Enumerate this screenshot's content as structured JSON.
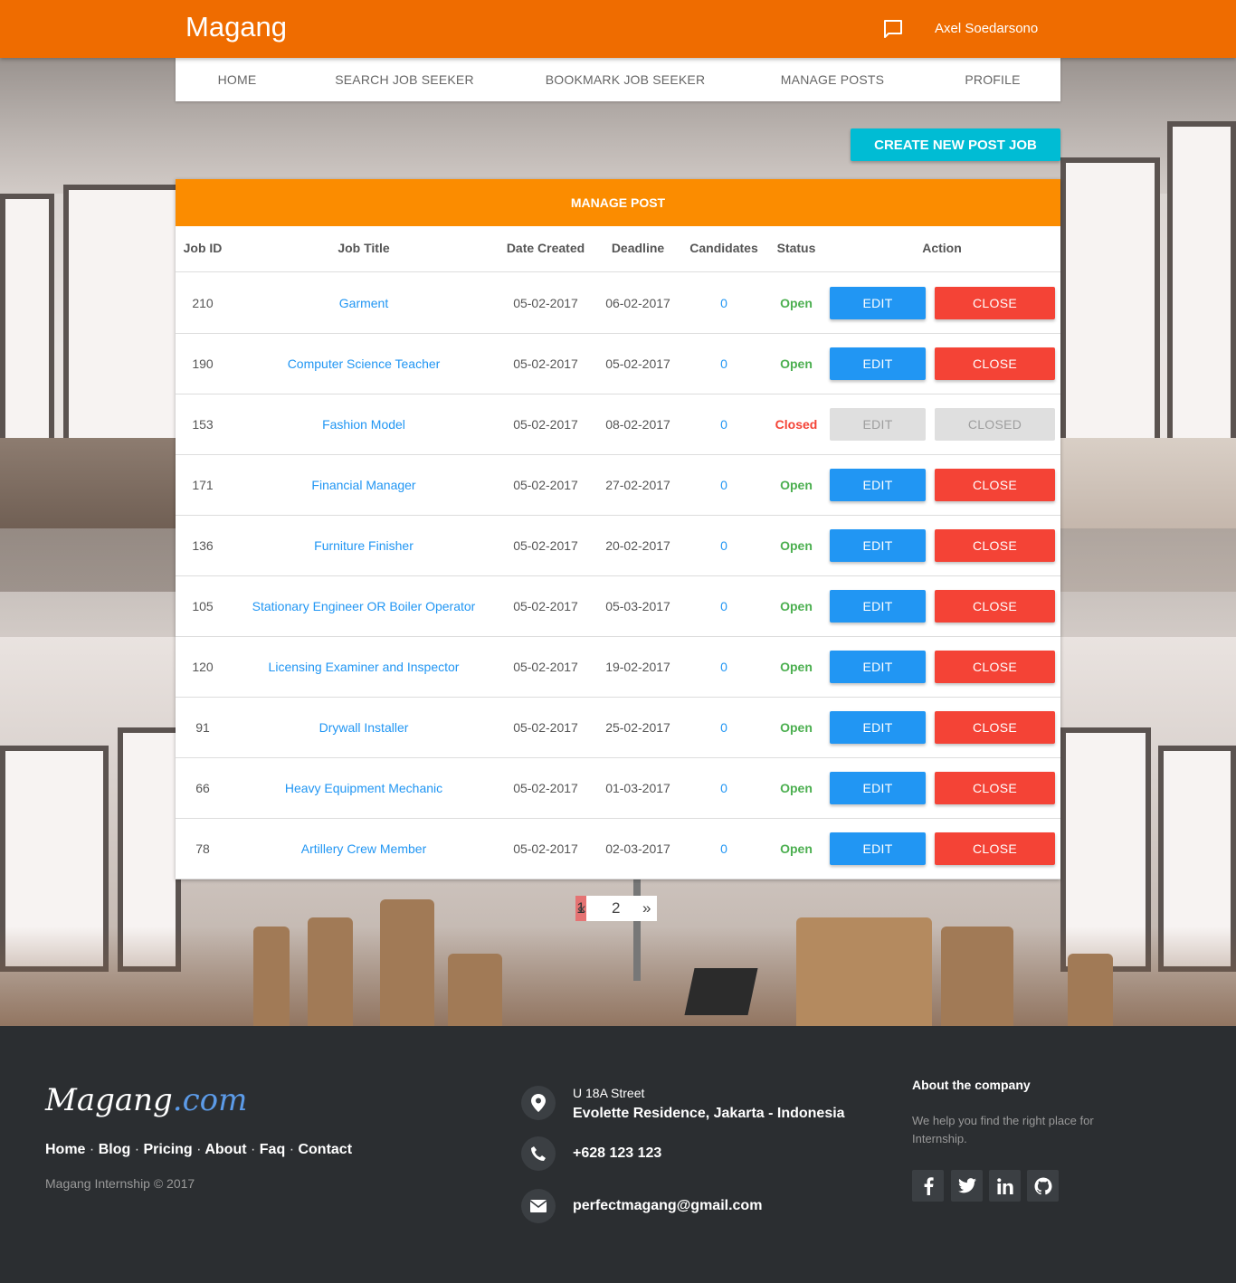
{
  "header": {
    "brand": "Magang",
    "user_name": "Axel Soedarsono",
    "icon": "chat-icon"
  },
  "nav": {
    "items": [
      "HOME",
      "SEARCH JOB SEEKER",
      "BOOKMARK JOB SEEKER",
      "MANAGE POSTS",
      "PROFILE"
    ]
  },
  "actions": {
    "create_label": "CREATE NEW POST JOB"
  },
  "card": {
    "title": "MANAGE POST",
    "columns": [
      "Job ID",
      "Job Title",
      "Date Created",
      "Deadline",
      "Candidates",
      "Status",
      "Action"
    ],
    "rows": [
      {
        "id": "210",
        "title": "Garment",
        "created": "05-02-2017",
        "deadline": "06-02-2017",
        "candidates": "0",
        "status": "Open",
        "edit_label": "EDIT",
        "action_label": "CLOSE"
      },
      {
        "id": "190",
        "title": "Computer Science Teacher",
        "created": "05-02-2017",
        "deadline": "05-02-2017",
        "candidates": "0",
        "status": "Open",
        "edit_label": "EDIT",
        "action_label": "CLOSE"
      },
      {
        "id": "153",
        "title": "Fashion Model",
        "created": "05-02-2017",
        "deadline": "08-02-2017",
        "candidates": "0",
        "status": "Closed",
        "edit_label": "EDIT",
        "action_label": "CLOSED"
      },
      {
        "id": "171",
        "title": "Financial Manager",
        "created": "05-02-2017",
        "deadline": "27-02-2017",
        "candidates": "0",
        "status": "Open",
        "edit_label": "EDIT",
        "action_label": "CLOSE"
      },
      {
        "id": "136",
        "title": "Furniture Finisher",
        "created": "05-02-2017",
        "deadline": "20-02-2017",
        "candidates": "0",
        "status": "Open",
        "edit_label": "EDIT",
        "action_label": "CLOSE"
      },
      {
        "id": "105",
        "title": "Stationary Engineer OR Boiler Operator",
        "created": "05-02-2017",
        "deadline": "05-03-2017",
        "candidates": "0",
        "status": "Open",
        "edit_label": "EDIT",
        "action_label": "CLOSE"
      },
      {
        "id": "120",
        "title": "Licensing Examiner and Inspector",
        "created": "05-02-2017",
        "deadline": "19-02-2017",
        "candidates": "0",
        "status": "Open",
        "edit_label": "EDIT",
        "action_label": "CLOSE"
      },
      {
        "id": "91",
        "title": "Drywall Installer",
        "created": "05-02-2017",
        "deadline": "25-02-2017",
        "candidates": "0",
        "status": "Open",
        "edit_label": "EDIT",
        "action_label": "CLOSE"
      },
      {
        "id": "66",
        "title": "Heavy Equipment Mechanic",
        "created": "05-02-2017",
        "deadline": "01-03-2017",
        "candidates": "0",
        "status": "Open",
        "edit_label": "EDIT",
        "action_label": "CLOSE"
      },
      {
        "id": "78",
        "title": "Artillery Crew Member",
        "created": "05-02-2017",
        "deadline": "02-03-2017",
        "candidates": "0",
        "status": "Open",
        "edit_label": "EDIT",
        "action_label": "CLOSE"
      }
    ]
  },
  "pagination": {
    "prev": "«",
    "pages": [
      "1",
      "2"
    ],
    "current": "1",
    "next": "»"
  },
  "footer": {
    "logo_main": "Magang",
    "logo_suffix": ".com",
    "links": [
      "Home",
      "Blog",
      "Pricing",
      "About",
      "Faq",
      "Contact"
    ],
    "link_separator": "·",
    "copyright": "Magang Internship © 2017",
    "address_line1": "U 18A Street",
    "address_line2": "Evolette Residence, Jakarta - Indonesia",
    "phone": "+628 123 123",
    "email": "perfectmagang@gmail.com",
    "about_heading": "About the company",
    "about_text": "We help you find the right place for Internship.",
    "social_icons": [
      "facebook-icon",
      "twitter-icon",
      "linkedin-icon",
      "github-icon"
    ]
  },
  "colors": {
    "header": "#ef6c00",
    "card_header": "#fb8c00",
    "create_button": "#00bcd4",
    "edit_button": "#2196f3",
    "close_button": "#f44336",
    "disabled_button": "#dfdfdf",
    "disabled_text": "#9e9e9e",
    "link": "#2196f3",
    "status_open": "#4caf50",
    "status_closed": "#f44336",
    "footer_bg": "#2b2e31"
  }
}
